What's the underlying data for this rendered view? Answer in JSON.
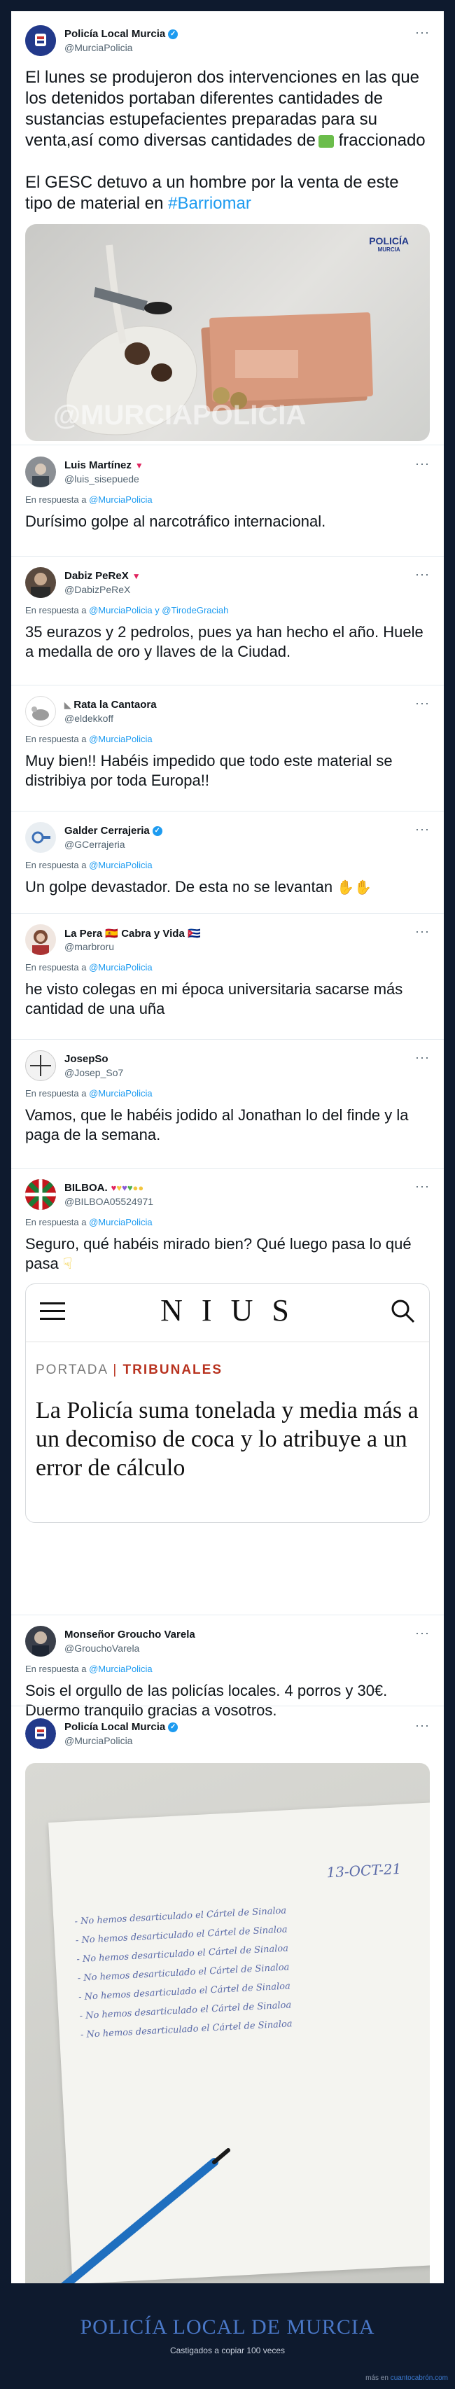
{
  "main_tweet": {
    "name": "Policía Local Murcia",
    "handle": "@MurciaPolicia",
    "text_p1": "El lunes se produjeron dos intervenciones en las que los detenidos portaban diferentes cantidades de sustancias estupefacientes preparadas para su venta,así como diversas cantidades de",
    "text_p1_end": " fraccionado",
    "text_p2": "El GESC detuvo a un hombre por la venta de este tipo de material en ",
    "hashtag": "#Barriomar",
    "photo_logo_line1": "POLICÍA",
    "photo_logo_line2": "MURCIA",
    "watermark": "@MURCIAPOLICIA"
  },
  "reply_prefix": "En respuesta a",
  "replies": [
    {
      "name": "Luis Martínez",
      "handle": "@luis_sisepuede",
      "to": "@MurciaPolicia",
      "text": "Durísimo golpe al narcotráfico internacional."
    },
    {
      "name": "Dabiz PeReX",
      "handle": "@DabizPeReX",
      "to": "@MurciaPolicia y @TirodeGraciah",
      "text": "35 eurazos y 2 pedrolos, pues ya han hecho el año. Huele a medalla de oro y llaves de la Ciudad."
    },
    {
      "name": "Rata la Cantaora",
      "handle": "@eldekkoff",
      "to": "@MurciaPolicia",
      "text": "Muy bien!! Habéis impedido que todo este material se distribiya por toda Europa!!"
    },
    {
      "name": "Galder Cerrajeria",
      "handle": "@GCerrajeria",
      "to": "@MurciaPolicia",
      "text": "Un golpe devastador. De esta no se levantan"
    },
    {
      "name": "La Pera 🇪🇸 Cabra y Vida 🇨🇺",
      "handle": "@marbroru",
      "to": "@MurciaPolicia",
      "text": "he visto colegas en mi época universitaria sacarse más cantidad de una uña"
    },
    {
      "name": "JosepSo",
      "handle": "@Josep_So7",
      "to": "@MurciaPolicia",
      "text": "Vamos, que le habéis jodido al Jonathan lo del finde y la paga de la semana."
    },
    {
      "name": "BILBOA.",
      "handle": "@BILBOA05524971",
      "to": "@MurciaPolicia",
      "text": "Seguro, qué habéis mirado bien? Qué luego pasa lo qué pasa"
    },
    {
      "name": "Monseñor Groucho Varela",
      "handle": "@GrouchoVarela",
      "to": "@MurciaPolicia",
      "text": "Sois el orgullo de las policías locales. 4 porros y 30€. Duermo tranquilo gracias a vosotros."
    }
  ],
  "nius": {
    "logo": "N I U S",
    "section": "PORTADA",
    "subsection": "TRIBUNALES",
    "headline": "La Policía suma tonelada y media más a un decomiso de coca y lo atribuye a un error de cálculo"
  },
  "last_tweet": {
    "name": "Policía Local Murcia",
    "handle": "@MurciaPolicia",
    "note_date": "13-OCT-21",
    "note_lines": [
      "- No hemos desarticulado el Cártel de Sinaloa",
      "- No hemos desarticulado el Cártel de Sinaloa",
      "- No hemos desarticulado el Cártel de Sinaloa",
      "- No hemos desarticulado el Cártel de Sinaloa",
      "- No hemos desarticulado el Cártel de Sinaloa",
      "- No hemos desarticulado el Cártel de Sinaloa",
      "- No hemos desarticulado el Cártel de Sinaloa"
    ]
  },
  "footer": {
    "title": "POLICÍA LOCAL DE MURCIA",
    "subtitle": "Castigados a copiar 100 veces",
    "source_prefix": "más en",
    "source_brand": "cuantocabrón.com"
  },
  "more_icon": "···",
  "colors": {
    "link": "#1d9bf0",
    "verified": "#1d9bf0",
    "footer_bg": "#0e1a2e",
    "footer_title": "#4a78c8"
  }
}
